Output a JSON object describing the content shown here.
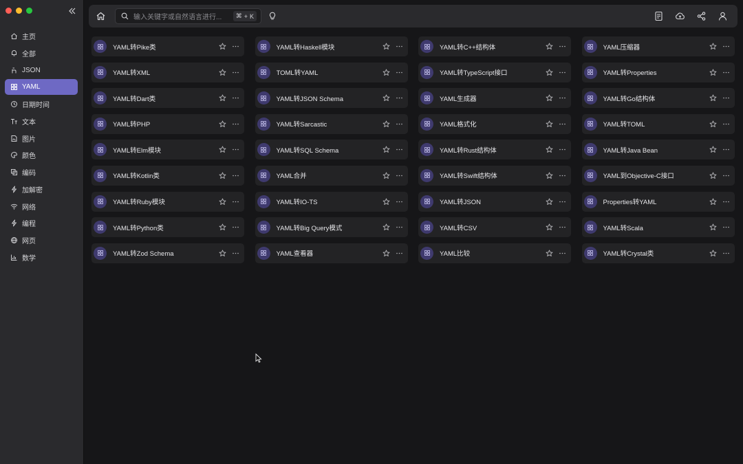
{
  "window": {
    "traffic_lights": [
      "#ff5f57",
      "#febc2e",
      "#28c840"
    ]
  },
  "sidebar": {
    "collapse_icon": "chevrons-left-icon",
    "items": [
      {
        "label": "主页",
        "icon": "home-icon",
        "active": false
      },
      {
        "label": "全部",
        "icon": "bell-icon",
        "active": false
      },
      {
        "label": "JSON",
        "icon": "hand-icon",
        "active": false
      },
      {
        "label": "YAML",
        "icon": "grid-icon",
        "active": true
      },
      {
        "label": "日期时间",
        "icon": "clock-icon",
        "active": false
      },
      {
        "label": "文本",
        "icon": "text-icon",
        "active": false
      },
      {
        "label": "图片",
        "icon": "file-image-icon",
        "active": false
      },
      {
        "label": "颜色",
        "icon": "palette-icon",
        "active": false
      },
      {
        "label": "编码",
        "icon": "copy-icon",
        "active": false
      },
      {
        "label": "加解密",
        "icon": "zap-icon",
        "active": false
      },
      {
        "label": "网络",
        "icon": "wifi-icon",
        "active": false
      },
      {
        "label": "编程",
        "icon": "bolt-icon",
        "active": false
      },
      {
        "label": "网页",
        "icon": "globe-icon",
        "active": false
      },
      {
        "label": "数学",
        "icon": "bar-chart-icon",
        "active": false
      }
    ],
    "accent": "#6e69c4"
  },
  "topbar": {
    "search_placeholder": "输入关键字或自然语言进行...",
    "shortcut_cmd": "⌘",
    "shortcut_plus": "+",
    "shortcut_key": "K"
  },
  "tools": [
    "YAML转Pike类",
    "YAML转Haskell模块",
    "YAML转C++结构体",
    "YAML压缩器",
    "YAML转XML",
    "TOML转YAML",
    "YAML转TypeScript接口",
    "YAML转Properties",
    "YAML转Dart类",
    "YAML转JSON Schema",
    "YAML生成器",
    "YAML转Go结构体",
    "YAML转PHP",
    "YAML转Sarcastic",
    "YAML格式化",
    "YAML转TOML",
    "YAML转Elm模块",
    "YAML转SQL Schema",
    "YAML转Rust结构体",
    "YAML转Java Bean",
    "YAML转Kotlin类",
    "YAML合并",
    "YAML转Swift结构体",
    "YAML到Objective-C接口",
    "YAML转Ruby模块",
    "YAML转IO-TS",
    "YAML转JSON",
    "Properties转YAML",
    "YAML转Python类",
    "YAML转Big Query模式",
    "YAML转CSV",
    "YAML转Scala",
    "YAML转Zod Schema",
    "YAML查看器",
    "YAML比较",
    "YAML转Crystal类"
  ]
}
